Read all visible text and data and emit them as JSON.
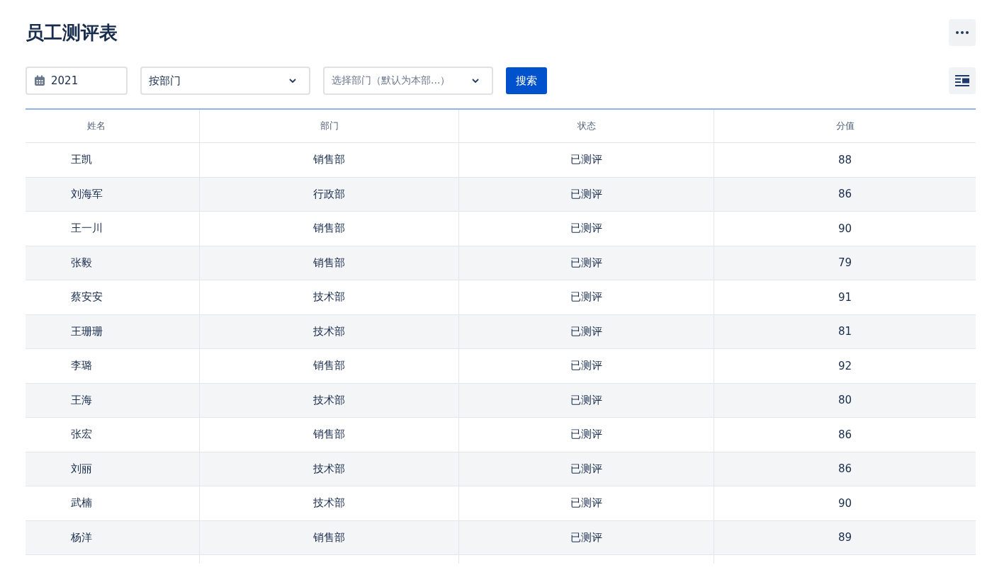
{
  "title": "员工测评表",
  "filters": {
    "year": "2021",
    "group_by": "按部门",
    "department": {
      "placeholder": "选择部门（默认为本部...）"
    },
    "search_button": "搜索"
  },
  "table": {
    "columns": [
      "姓名",
      "部门",
      "状态",
      "分值"
    ],
    "rows": [
      [
        "王凯",
        "销售部",
        "已测评",
        "88"
      ],
      [
        "刘海军",
        "行政部",
        "已测评",
        "86"
      ],
      [
        "王一川",
        "销售部",
        "已测评",
        "90"
      ],
      [
        "张毅",
        "销售部",
        "已测评",
        "79"
      ],
      [
        "蔡安安",
        "技术部",
        "已测评",
        "91"
      ],
      [
        "王珊珊",
        "技术部",
        "已测评",
        "81"
      ],
      [
        "李璐",
        "销售部",
        "已测评",
        "92"
      ],
      [
        "王海",
        "技术部",
        "已测评",
        "80"
      ],
      [
        "张宏",
        "销售部",
        "已测评",
        "86"
      ],
      [
        "刘丽",
        "技术部",
        "已测评",
        "86"
      ],
      [
        "武楠",
        "技术部",
        "已测评",
        "90"
      ],
      [
        "杨洋",
        "销售部",
        "已测评",
        "89"
      ]
    ]
  }
}
